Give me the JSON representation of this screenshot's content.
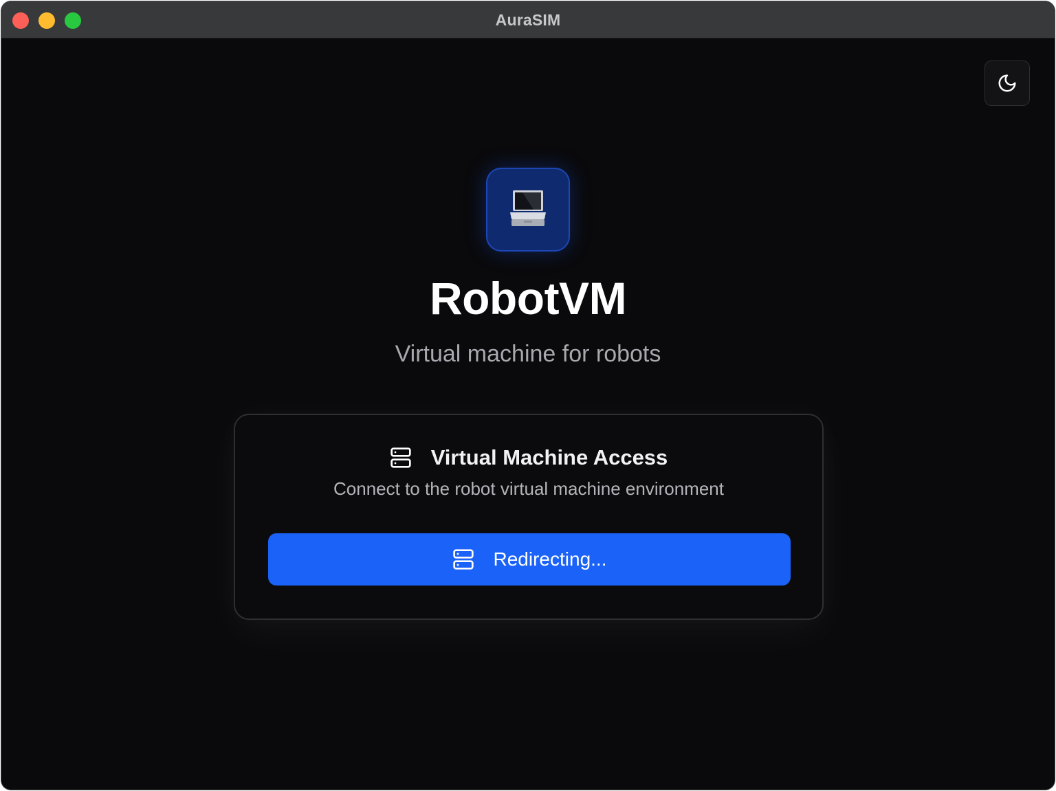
{
  "window": {
    "title": "AuraSIM"
  },
  "header": {
    "theme_toggle_icon": "moon-icon"
  },
  "hero": {
    "logo_icon": "laptop-icon",
    "title": "RobotVM",
    "subtitle": "Virtual machine for robots"
  },
  "card": {
    "icon": "server-icon",
    "title": "Virtual Machine Access",
    "description": "Connect to the robot virtual machine environment",
    "button": {
      "icon": "server-icon",
      "label": "Redirecting..."
    }
  },
  "colors": {
    "accent": "#1b62f8",
    "background": "#0a0a0c",
    "logo_bg": "#0f2a6e",
    "close": "#fe5f57",
    "minimize": "#febc2e",
    "zoom": "#28c840"
  }
}
